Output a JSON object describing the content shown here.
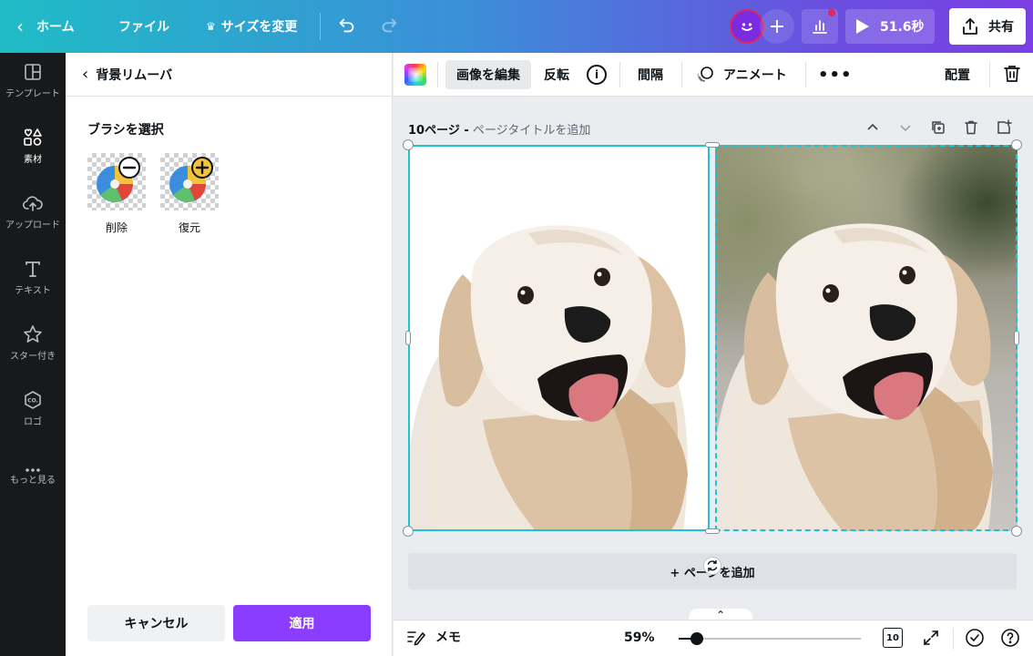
{
  "topbar": {
    "home_label": "ホーム",
    "file_label": "ファイル",
    "resize_label": "サイズを変更",
    "present_label": "51.6秒",
    "share_label": "共有"
  },
  "rail": {
    "items": [
      {
        "label": "テンプレート",
        "icon": "template-icon"
      },
      {
        "label": "素材",
        "icon": "elements-icon"
      },
      {
        "label": "アップロード",
        "icon": "upload-icon"
      },
      {
        "label": "テキスト",
        "icon": "text-icon"
      },
      {
        "label": "スター付き",
        "icon": "star-icon"
      },
      {
        "label": "ロゴ",
        "icon": "logo-icon"
      },
      {
        "label": "もっと見る",
        "icon": "more-icon"
      }
    ],
    "active_index": 1
  },
  "panel": {
    "title": "背景リムーバ",
    "brush_heading": "ブラシを選択",
    "brushes": [
      {
        "label": "削除",
        "icon": "minus-icon"
      },
      {
        "label": "復元",
        "icon": "plus-icon"
      }
    ],
    "cancel_label": "キャンセル",
    "apply_label": "適用",
    "apply_color": "#8b3dff"
  },
  "toolbar": {
    "edit_image_label": "画像を編集",
    "flip_label": "反転",
    "spacing_label": "間隔",
    "animate_label": "アニメート",
    "position_label": "配置"
  },
  "canvas": {
    "page_number_label": "10ページ -",
    "page_title_placeholder": "ページタイトルを追加",
    "add_page_label": "+ ページを追加",
    "selection_color": "#1fc4d4"
  },
  "bottombar": {
    "notes_label": "メモ",
    "zoom_label": "59%",
    "zoom_value": 59,
    "pages_count": "10"
  }
}
